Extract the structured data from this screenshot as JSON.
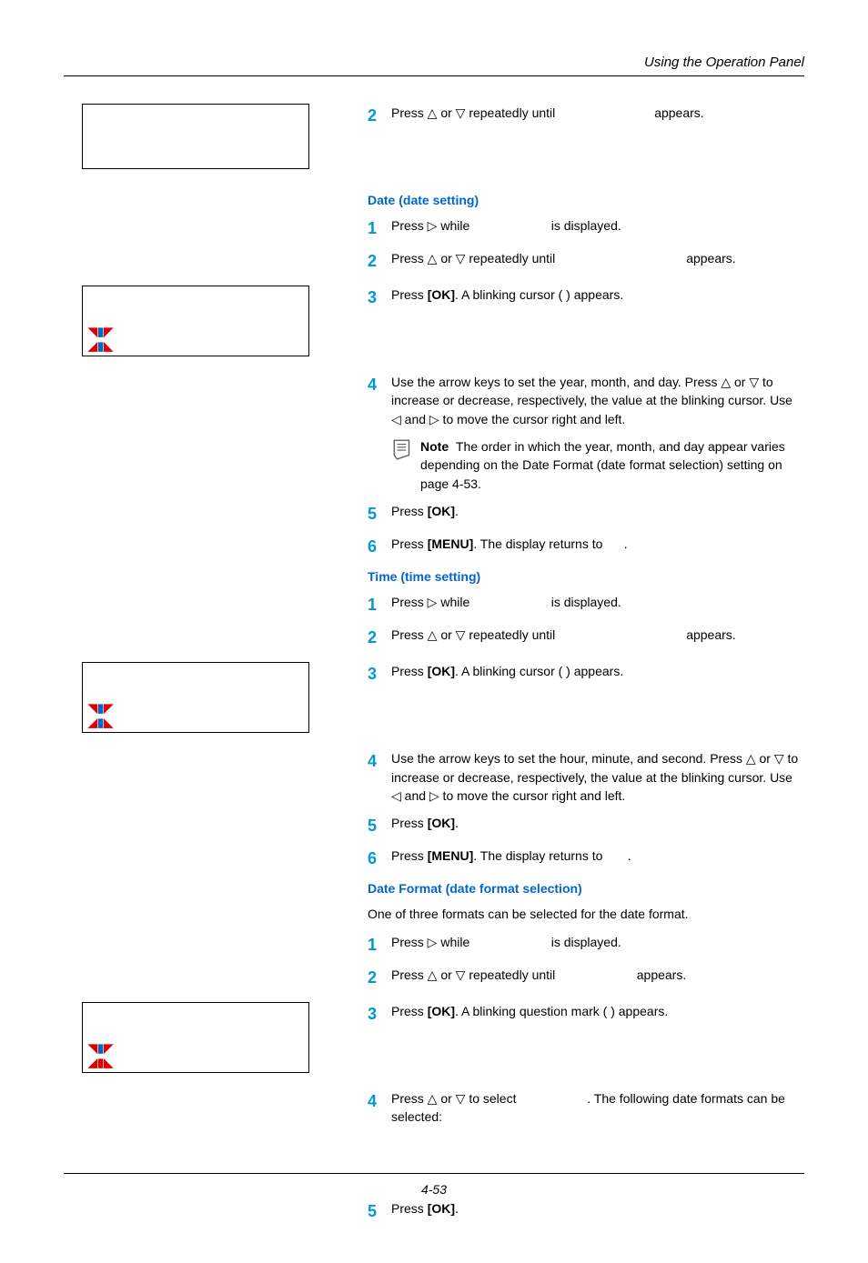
{
  "header": {
    "title": "Using the Operation Panel"
  },
  "sec0": {
    "s2": "Press △ or ▽ repeatedly until",
    "s2b": "appears."
  },
  "date": {
    "heading": "Date (date setting)",
    "s1a": "Press ▷ while",
    "s1b": "is displayed.",
    "s2a": "Press △ or ▽ repeatedly until",
    "s2b": "appears.",
    "s3": "Press [OK]. A blinking cursor ( ) appears.",
    "s4": "Use the arrow keys to set the year, month, and day. Press △ or ▽ to increase or decrease, respectively, the value at the blinking cursor. Use ◁ and ▷ to move the cursor right and left.",
    "note": "Note  The order in which the year, month, and day appear varies depending on the Date Format (date format selection) setting on page 4-53.",
    "s5": "Press [OK].",
    "s6a": "Press [MENU]. The display returns to",
    "s6b": "."
  },
  "time": {
    "heading": "Time (time setting)",
    "s1a": "Press ▷ while",
    "s1b": "is displayed.",
    "s2a": "Press △ or ▽ repeatedly until",
    "s2b": "appears.",
    "s3": "Press [OK]. A blinking cursor ( ) appears.",
    "s4": "Use the arrow keys to set the hour, minute, and second. Press △ or ▽ to increase or decrease, respectively, the value at the blinking cursor. Use ◁ and ▷ to move the cursor right and left.",
    "s5": "Press [OK].",
    "s6a": "Press [MENU]. The display returns to",
    "s6b": "."
  },
  "fmt": {
    "heading": "Date Format (date format selection)",
    "intro": "One of three formats can be selected for the date format.",
    "s1a": "Press ▷ while",
    "s1b": "is displayed.",
    "s2a": "Press △ or ▽ repeatedly until",
    "s2b": "appears.",
    "s3": "Press [OK]. A blinking question mark ( ) appears.",
    "s4a": "Press △ or ▽ to select",
    "s4b": ". The following date formats can be selected:",
    "s5": "Press [OK]."
  },
  "footer": {
    "page": "4-53"
  }
}
